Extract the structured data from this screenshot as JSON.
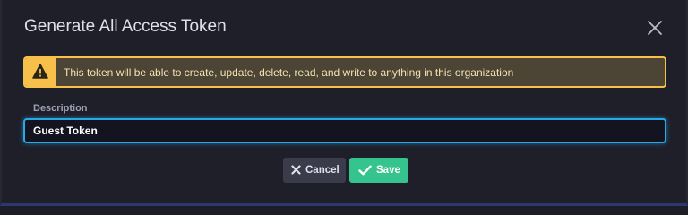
{
  "dialog": {
    "title": "Generate All Access Token",
    "close_icon": "close-icon"
  },
  "alert": {
    "icon": "warning-icon",
    "text": "This token will be able to create, update, delete, read, and write to anything in this organization",
    "color": "#f6c04a"
  },
  "form": {
    "description_label": "Description",
    "description_value": "Guest Token"
  },
  "buttons": {
    "cancel_label": "Cancel",
    "cancel_icon": "x-icon",
    "save_label": "Save",
    "save_icon": "checkmark-icon",
    "save_color": "#35c48e"
  },
  "colors": {
    "focus_border": "#29a8e6",
    "background": "#1e1f29"
  }
}
